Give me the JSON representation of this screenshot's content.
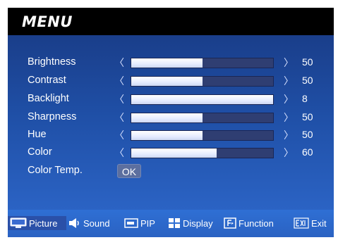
{
  "menu": {
    "title": "MENU"
  },
  "settings": [
    {
      "label": "Brightness",
      "value": "50",
      "level": 0.5
    },
    {
      "label": "Contrast",
      "value": "50",
      "level": 0.5
    },
    {
      "label": "Backlight",
      "value": "8",
      "level": 1.0
    },
    {
      "label": "Sharpness",
      "value": "50",
      "level": 0.5
    },
    {
      "label": "Hue",
      "value": "50",
      "level": 0.5
    },
    {
      "label": "Color",
      "value": "60",
      "level": 0.6
    }
  ],
  "color_temp": {
    "label": "Color Temp.",
    "button": "OK"
  },
  "arrows": {
    "left": "〈",
    "right": "〉"
  },
  "tabs": [
    {
      "label": "Picture",
      "icon": "monitor-icon",
      "active": true
    },
    {
      "label": "Sound",
      "icon": "speaker-icon",
      "active": false
    },
    {
      "label": "PIP",
      "icon": "pip-icon",
      "active": false
    },
    {
      "label": "Display",
      "icon": "display-grid-icon",
      "active": false
    },
    {
      "label": "Function",
      "icon": "function-icon",
      "active": false
    },
    {
      "label": "Exit",
      "icon": "exit-icon",
      "active": false
    }
  ],
  "colors": {
    "header_bg": "#000000",
    "body_bg": "#1f4fa6",
    "footer_bg": "#2f6fd4",
    "bar_fill": "#ffffff",
    "bar_track": "#2f3e72",
    "active_tab": "#2a50a8"
  }
}
